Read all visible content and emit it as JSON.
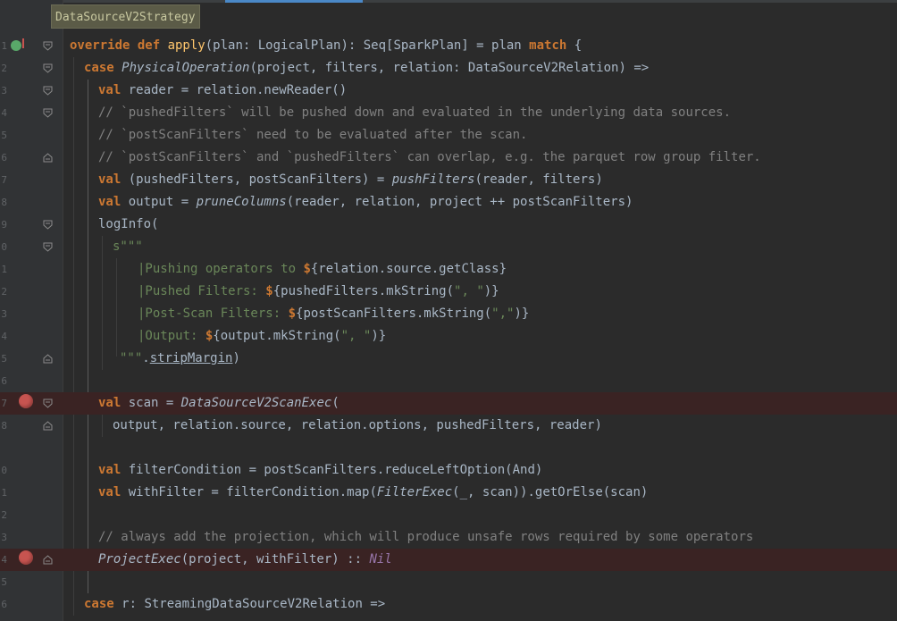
{
  "breadcrumb": "DataSourceV2Strategy",
  "line_numbers": [
    "1",
    "2",
    "3",
    "4",
    "5",
    "6",
    "7",
    "8",
    "9",
    "0",
    "1",
    "2",
    "3",
    "4",
    "5",
    "6",
    "7",
    "8",
    "",
    "0",
    "1",
    "2",
    "3",
    "4",
    "5",
    "6"
  ],
  "code": {
    "l1": {
      "kw1": "override def ",
      "fn": "apply",
      "rest": "(plan: LogicalPlan): Seq[SparkPlan] = plan ",
      "kw2": "match",
      " tail": " {"
    },
    "l2": {
      "kw": "case ",
      "it": "PhysicalOperation",
      "rest": "(project, filters, relation: DataSourceV2Relation) =>"
    },
    "l3": {
      "kw": "val ",
      "rest": "reader = relation.newReader()"
    },
    "l4": {
      "cm": "// `pushedFilters` will be pushed down and evaluated in the underlying data sources."
    },
    "l5": {
      "cm": "// `postScanFilters` need to be evaluated after the scan."
    },
    "l6": {
      "cm": "// `postScanFilters` and `pushedFilters` can overlap, e.g. the parquet row group filter."
    },
    "l7": {
      "kw": "val ",
      "a": "(pushedFilters, postScanFilters) = ",
      "it": "pushFilters",
      "b": "(reader, filters)"
    },
    "l8": {
      "kw": "val ",
      "a": "output = ",
      "it": "pruneColumns",
      "b": "(reader, relation, project ++ postScanFilters)"
    },
    "l9": {
      "text": "logInfo("
    },
    "l10": {
      "str": "s\"\"\""
    },
    "l11": {
      "str": "|Pushing operators to ",
      "d": "$",
      "rest": "{relation.source.getClass}"
    },
    "l12": {
      "str": "|Pushed Filters: ",
      "d": "$",
      "a": "{pushedFilters.mkString(",
      "s": "\", \"",
      "b": ")}"
    },
    "l13": {
      "str": "|Post-Scan Filters: ",
      "d": "$",
      "a": "{postScanFilters.mkString(",
      "s": "\",\"",
      "b": ")}"
    },
    "l14": {
      "str": "|Output: ",
      "d": "$",
      "a": "{output.mkString(",
      "s": "\", \"",
      "b": ")}"
    },
    "l15": {
      "str": "\"\"\"",
      "a": ".",
      "u": "stripMargin",
      "b": ")"
    },
    "l17": {
      "kw": "val ",
      "a": "scan = ",
      "it": "DataSourceV2ScanExec",
      "b": "("
    },
    "l18": {
      "text": "output, relation.source, relation.options, pushedFilters, reader)"
    },
    "l20": {
      "kw": "val ",
      "rest": "filterCondition = postScanFilters.reduceLeftOption(And)"
    },
    "l21": {
      "kw": "val ",
      "a": "withFilter = filterCondition.map(",
      "it": "FilterExec",
      "b": "(_, scan)).getOrElse(scan)"
    },
    "l23": {
      "cm": "// always add the projection, which will produce unsafe rows required by some operators"
    },
    "l24": {
      "it": "ProjectExec",
      "a": "(project, withFilter) :: ",
      "nil": "Nil"
    },
    "l26": {
      "kw": "case ",
      "rest": "r: StreamingDataSourceV2Relation =>"
    }
  },
  "colors": {
    "background": "#2b2b2b",
    "gutter": "#313335",
    "keyword": "#cc7832",
    "function": "#ffc66d",
    "comment": "#808080",
    "string": "#6a8759",
    "breakpoint": "#c75450",
    "breakpoint_line": "#3a2323"
  },
  "icons": [
    "override-icon",
    "breakpoint-icon",
    "fold-icon"
  ]
}
